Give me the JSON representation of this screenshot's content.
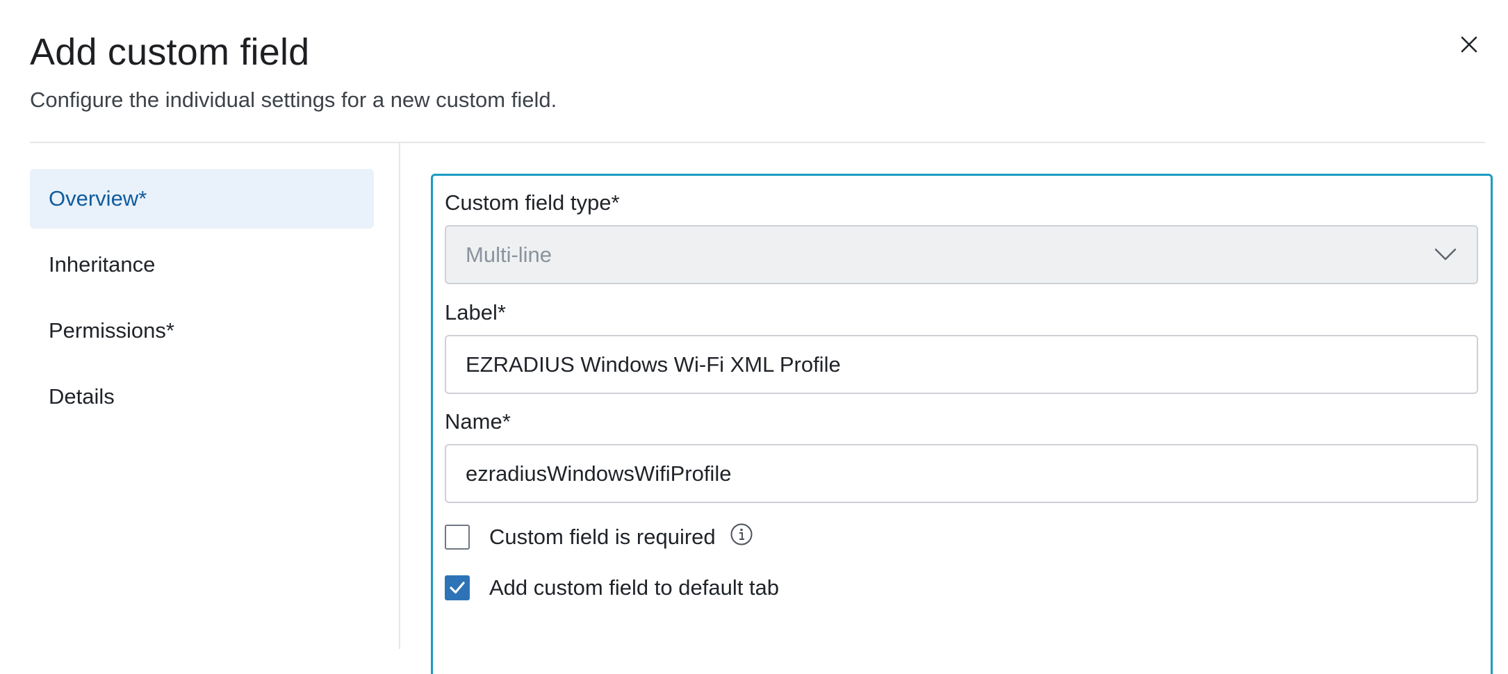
{
  "dialog": {
    "title": "Add custom field",
    "subtitle": "Configure the individual settings for a new custom field.",
    "close_icon": "close-icon"
  },
  "nav": {
    "items": [
      {
        "label": "Overview*",
        "active": true
      },
      {
        "label": "Inheritance",
        "active": false
      },
      {
        "label": "Permissions*",
        "active": false
      },
      {
        "label": "Details",
        "active": false
      }
    ]
  },
  "form": {
    "type_label": "Custom field type*",
    "type_value": "Multi-line",
    "label_label": "Label*",
    "label_value": "EZRADIUS Windows Wi-Fi XML Profile",
    "name_label": "Name*",
    "name_value": "ezradiusWindowsWifiProfile",
    "required_label": "Custom field is required",
    "required_checked": false,
    "default_tab_label": "Add custom field to default tab",
    "default_tab_checked": true
  },
  "colors": {
    "accent": "#1b9bc2",
    "active_nav_bg": "#e9f1fa",
    "active_nav_text": "#0f5c9c",
    "checkbox_checked": "#2f73b7"
  }
}
